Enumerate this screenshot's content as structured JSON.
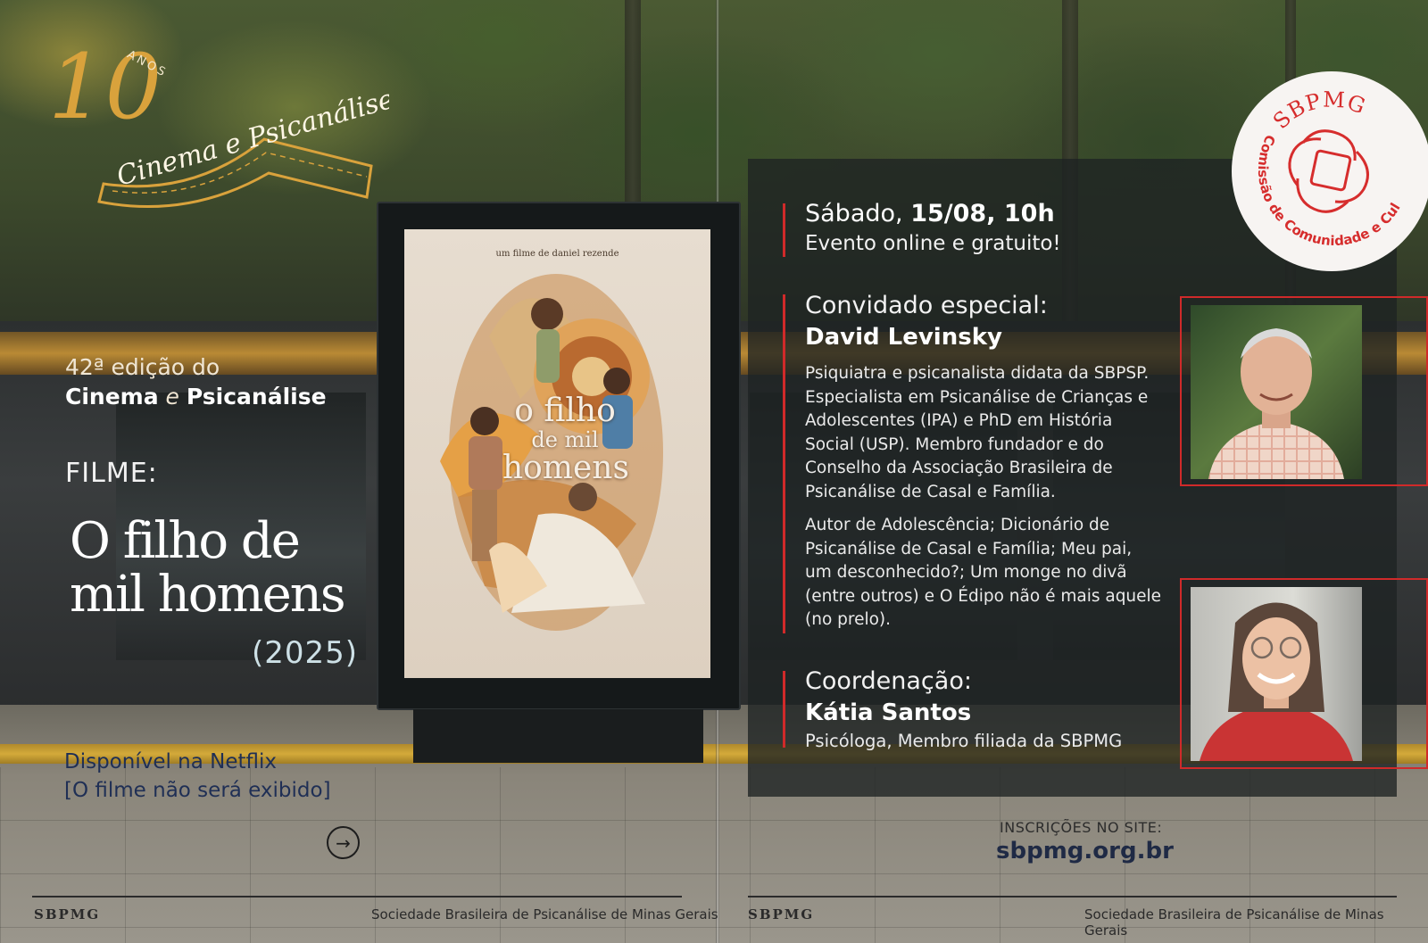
{
  "anniversary_logo": {
    "number": "10",
    "anos": "ANOS",
    "script": "Cinema e Psicanálise"
  },
  "left": {
    "edition_line1": "42ª edição do",
    "edition_cinema": "Cinema",
    "edition_e": "e",
    "edition_psicanalise": "Psicanálise",
    "filme_label": "FILME:",
    "film_title": "O filho de mil homens",
    "film_year": "(2025)",
    "netflix_line1": "Disponível na Netflix",
    "netflix_line2": "[O filme não será exibido]"
  },
  "poster": {
    "credit": "um filme de daniel rezende",
    "title_line1": "o filho",
    "title_line2": "de mil",
    "title_line3": "homens"
  },
  "right": {
    "date_prefix": "Sábado,",
    "date_bold": "15/08, 10h",
    "online": "Evento online e gratuito!",
    "guest_label": "Convidado especial:",
    "guest_name": "David Levinsky",
    "bio": "Psiquiatra e psicanalista didata da SBPSP. Especialista em Psicanálise de Crianças e Adolescentes (IPA) e PhD em História Social (USP). Membro fundador e do Conselho da Associação Brasileira de Psicanálise de Casal e Família.",
    "bio2": "Autor de Adolescência; Dicionário de Psicanálise de Casal e Família; Meu pai, um desconhecido?; Um monge no divã (entre outros) e O Édipo não é mais aquele (no prelo).",
    "coord_label": "Coordenação:",
    "coord_name": "Kátia Santos",
    "coord_role": "Psicóloga, Membro filiada da SBPMG",
    "inscricoes_label": "INSCRIÇÕES NO SITE:",
    "inscricoes_url": "sbpmg.org.br"
  },
  "badge": {
    "title": "SBPMG",
    "subtitle": "Comissão de Comunidade e Cultura"
  },
  "footer": {
    "logo": "SBPMG",
    "org_name": "Sociedade Brasileira de Psicanálise de Minas Gerais"
  },
  "colors": {
    "accent_red": "#d02a2a",
    "gold": "#d9a23c",
    "navy": "#1f2a45"
  },
  "icons": {
    "arrow": "arrow-right-circle-icon",
    "badge_hands": "hands-circle-icon"
  }
}
